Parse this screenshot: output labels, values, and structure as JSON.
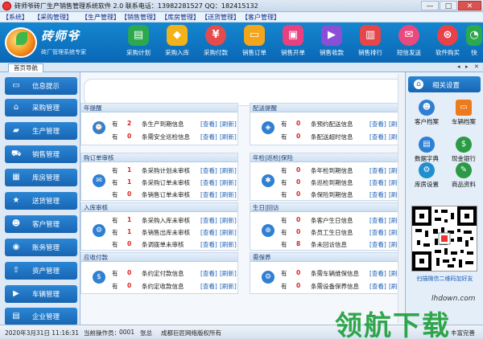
{
  "window": {
    "title": "砖师爷砖厂生产销售管理系统软件 2.0 联系电话：13982281527 QQ：182415132",
    "min": "—",
    "max": "□",
    "close": "✕"
  },
  "menu": [
    "【系统】",
    "【采购管理】",
    "【生产管理】",
    "【销售管理】",
    "【库房管理】",
    "【送货管理】",
    "【客户管理】"
  ],
  "logo": {
    "name": "砖师爷",
    "slogan": "砖厂管理系统专家"
  },
  "toolbar": [
    {
      "label": "采购计划",
      "icon": "clipboard-icon",
      "color": "#2ca84e"
    },
    {
      "label": "采购入库",
      "icon": "box-in-icon",
      "color": "#f2b31a"
    },
    {
      "label": "采购付款",
      "icon": "yen-pin-icon",
      "color": "#e64b4b"
    },
    {
      "label": "销售订单",
      "icon": "tv-icon",
      "color": "#f3a51c"
    },
    {
      "label": "销售开单",
      "icon": "bag-icon",
      "color": "#e8417f"
    },
    {
      "label": "销售收款",
      "icon": "play-icon",
      "color": "#8a4fd6"
    },
    {
      "label": "销售排行",
      "icon": "barchart-icon",
      "color": "#e5464a"
    },
    {
      "label": "短信发送",
      "icon": "message-icon",
      "color": "#e84a7e"
    },
    {
      "label": "软件购买",
      "icon": "cart-icon",
      "color": "#e8414a"
    },
    {
      "label": "快",
      "icon": "clock-icon",
      "color": "#2ca84e"
    }
  ],
  "tab": {
    "label": "首页导航",
    "close": "✕",
    "prev": "◂",
    "next": "▸"
  },
  "sidebar": [
    {
      "label": "信息提示",
      "icon": "monitor-icon"
    },
    {
      "label": "采购管理",
      "icon": "home-icon"
    },
    {
      "label": "生产管理",
      "icon": "truck-icon"
    },
    {
      "label": "销售管理",
      "icon": "cart-icon"
    },
    {
      "label": "库房管理",
      "icon": "warehouse-icon"
    },
    {
      "label": "送货管理",
      "icon": "star-icon"
    },
    {
      "label": "客户管理",
      "icon": "user-icon"
    },
    {
      "label": "账务管理",
      "icon": "money-icon"
    },
    {
      "label": "资产管理",
      "icon": "upload-icon"
    },
    {
      "label": "车辆管理",
      "icon": "car-icon"
    },
    {
      "label": "企业管理",
      "icon": "building-icon"
    }
  ],
  "panels": [
    {
      "title": "年提醒",
      "badge": "⌚",
      "rows": [
        {
          "you": "有",
          "count": "2",
          "desc": "条生产到期信息"
        },
        {
          "you": "有",
          "count": "0",
          "desc": "条需安全巡检信息"
        }
      ]
    },
    {
      "title": "配送提醒",
      "badge": "◈",
      "rows": [
        {
          "you": "有",
          "count": "0",
          "desc": "条预约配送信息"
        },
        {
          "you": "有",
          "count": "0",
          "desc": "条配送超时信息"
        }
      ]
    },
    {
      "title": "购订单审核",
      "badge": "✉",
      "rows": [
        {
          "you": "有",
          "count": "1",
          "desc": "条采购计划未审核"
        },
        {
          "you": "有",
          "count": "1",
          "desc": "条采购订单未审核"
        },
        {
          "you": "有",
          "count": "0",
          "desc": "条销售订单未审核"
        }
      ]
    },
    {
      "title": "年检|巡检|保险",
      "badge": "✱",
      "rows": [
        {
          "you": "有",
          "count": "0",
          "desc": "条年检到期信息"
        },
        {
          "you": "有",
          "count": "0",
          "desc": "条巡检到期信息"
        },
        {
          "you": "有",
          "count": "0",
          "desc": "条保险到期信息"
        }
      ]
    },
    {
      "title": "入库审核",
      "badge": "⚙",
      "rows": [
        {
          "you": "有",
          "count": "1",
          "desc": "条采购入库未审核"
        },
        {
          "you": "有",
          "count": "1",
          "desc": "条销售出库未审核"
        },
        {
          "you": "有",
          "count": "0",
          "desc": "条调拨单未审核"
        }
      ]
    },
    {
      "title": "生日|回访",
      "badge": "⊕",
      "rows": [
        {
          "you": "有",
          "count": "0",
          "desc": "条客户生日信息"
        },
        {
          "you": "有",
          "count": "0",
          "desc": "条员工生日信息"
        },
        {
          "you": "有",
          "count": "8",
          "desc": "条未回访信息"
        }
      ]
    },
    {
      "title": "应收付款",
      "badge": "$",
      "rows": [
        {
          "you": "有",
          "count": "0",
          "desc": "条约定付款信息"
        },
        {
          "you": "有",
          "count": "0",
          "desc": "条约定收款信息"
        }
      ]
    },
    {
      "title": "需保养",
      "badge": "⚙",
      "rows": [
        {
          "you": "有",
          "count": "0",
          "desc": "条需车辆维保信息"
        },
        {
          "you": "有",
          "count": "0",
          "desc": "条需设备保养信息"
        }
      ]
    }
  ],
  "links": {
    "view": "[查看]",
    "refresh": "[刷新]"
  },
  "right": {
    "header": "相关设置",
    "tools": [
      {
        "label": "客户档案",
        "icon": "users-icon",
        "color": "#2f7fd3"
      },
      {
        "label": "车辆档案",
        "icon": "screen-icon",
        "color": "#ef7a1c"
      },
      {
        "label": "数据字典",
        "icon": "book-icon",
        "color": "#2f7fd3"
      },
      {
        "label": "现金银行",
        "icon": "bank-icon",
        "color": "#2a9a45"
      },
      {
        "label": "库房设置",
        "icon": "gear-icon",
        "color": "#1f8fd0"
      },
      {
        "label": "商品资料",
        "icon": "pencil-icon",
        "color": "#2a9a45"
      }
    ],
    "qr_caption": "扫描微信二维码加好友"
  },
  "status": {
    "datetime": "2020年3月31日  11:16:31",
    "operator_label": "当前操作员：",
    "operator_id": "0001",
    "operator_name": "张总",
    "company": "成都巨匠网络版权所有",
    "right": "丰富完善"
  },
  "watermark": {
    "url": "lhdown.com",
    "text": "领航下载"
  }
}
